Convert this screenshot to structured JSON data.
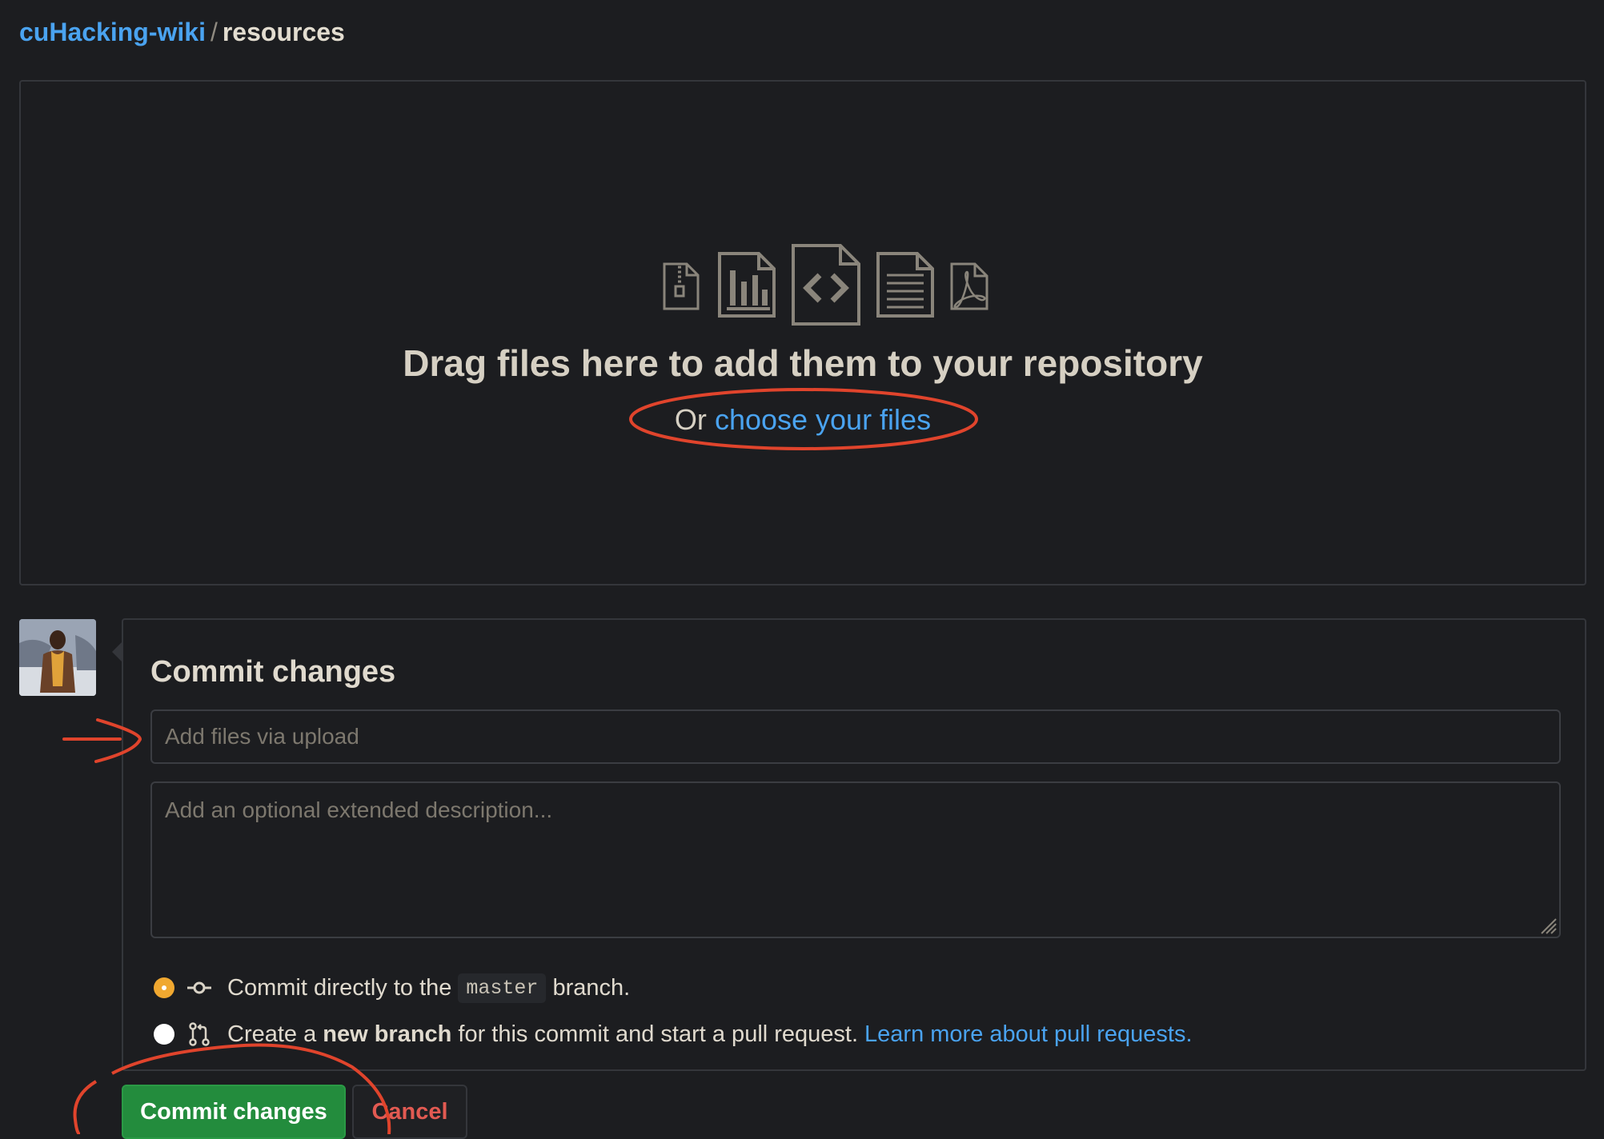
{
  "breadcrumb": {
    "owner": "cuHacking-wiki",
    "separator": "/",
    "repo": "resources"
  },
  "dropzone": {
    "title": "Drag files here to add them to your repository",
    "sub_prefix": "Or",
    "choose_link": "choose your files",
    "icons": [
      "file-zip-icon",
      "file-chart-icon",
      "file-code-icon",
      "file-text-icon",
      "file-pdf-icon"
    ]
  },
  "commit": {
    "title": "Commit changes",
    "summary_placeholder": "Add files via upload",
    "description_placeholder": "Add an optional extended description...",
    "option_direct": {
      "before": "Commit directly to the",
      "branch": "master",
      "after": "branch.",
      "selected": true
    },
    "option_new_branch": {
      "before": "Create a",
      "bold": "new branch",
      "after": "for this commit and start a pull request.",
      "link": "Learn more about pull requests.",
      "selected": false
    }
  },
  "buttons": {
    "commit": "Commit changes",
    "cancel": "Cancel"
  },
  "colors": {
    "background": "#1c1d20",
    "link": "#4aa3f0",
    "primary_button": "#238c3d",
    "danger_text": "#e25a52",
    "radio_selected": "#f0a830",
    "annotation": "#e0442c"
  }
}
